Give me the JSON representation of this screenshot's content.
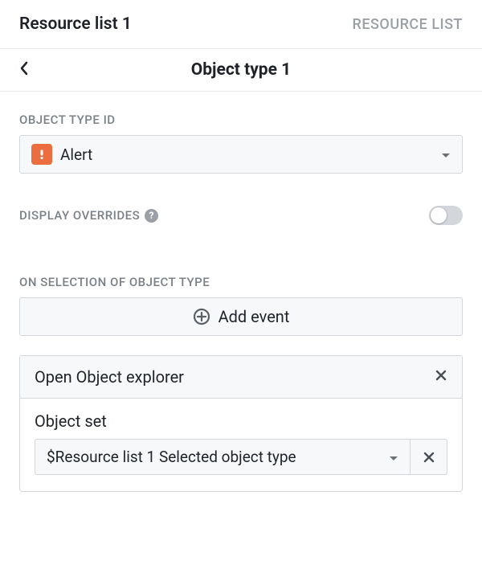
{
  "topbar": {
    "title": "Resource list 1",
    "type_label": "RESOURCE LIST"
  },
  "subheader": {
    "title": "Object type 1"
  },
  "object_type_id": {
    "label": "OBJECT TYPE ID",
    "selected": "Alert"
  },
  "display_overrides": {
    "label": "DISPLAY OVERRIDES",
    "enabled": false
  },
  "on_selection": {
    "label": "ON SELECTION OF OBJECT TYPE",
    "add_event_label": "Add event",
    "event": {
      "title": "Open Object explorer",
      "field_label": "Object set",
      "selected_value": "$Resource list 1 Selected object type"
    }
  }
}
